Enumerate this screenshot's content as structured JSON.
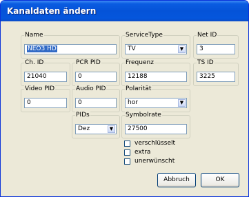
{
  "window": {
    "title": "Kanaldaten ändern"
  },
  "fields": {
    "name": {
      "label": "Name",
      "value": "NEO3 HD"
    },
    "service_type": {
      "label": "ServiceType",
      "value": "TV"
    },
    "net_id": {
      "label": "Net ID",
      "value": "3"
    },
    "ch_id": {
      "label": "Ch. ID",
      "value": "21040"
    },
    "pcr_pid": {
      "label": "PCR PID",
      "value": "0"
    },
    "frequenz": {
      "label": "Frequenz",
      "value": "12188"
    },
    "ts_id": {
      "label": "TS ID",
      "value": "3225"
    },
    "video_pid": {
      "label": "Video PID",
      "value": "0"
    },
    "audio_pid": {
      "label": "Audio PID",
      "value": "0"
    },
    "polaritaet": {
      "label": "Polarität",
      "value": "hor"
    },
    "pids": {
      "label": "PIDs",
      "value": "Dez"
    },
    "symbolrate": {
      "label": "Symbolrate",
      "value": "27500"
    }
  },
  "checkboxes": {
    "verschluesselt": {
      "label": "verschlüsselt",
      "checked": false
    },
    "extra": {
      "label": "extra",
      "checked": false
    },
    "unerwuenscht": {
      "label": "unerwünscht",
      "checked": false
    }
  },
  "buttons": {
    "cancel": "Abbruch",
    "ok": "OK"
  },
  "icons": {
    "dropdown": "chevron-down-icon"
  }
}
